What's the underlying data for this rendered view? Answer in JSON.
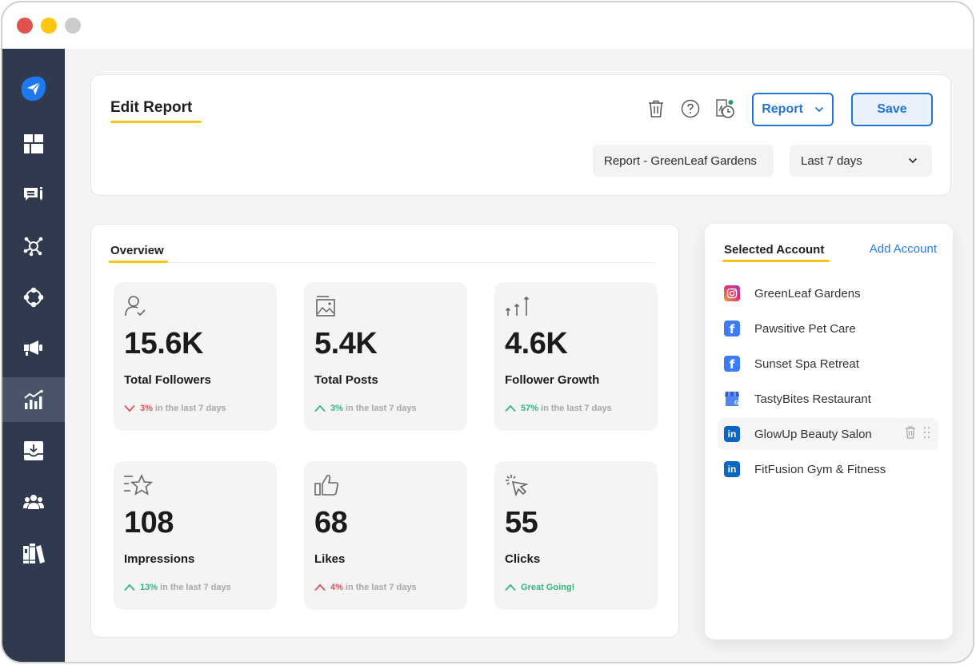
{
  "window": {
    "controls": [
      "close",
      "minimize",
      "maximize"
    ]
  },
  "sidebar": {
    "items": [
      {
        "name": "send",
        "icon": "paper-plane-icon",
        "active": false
      },
      {
        "name": "dashboard",
        "icon": "dashboard-grid-icon",
        "active": false
      },
      {
        "name": "messages",
        "icon": "chat-edit-icon",
        "active": false
      },
      {
        "name": "network",
        "icon": "network-hub-icon",
        "active": false
      },
      {
        "name": "connections",
        "icon": "circle-nodes-icon",
        "active": false
      },
      {
        "name": "campaigns",
        "icon": "megaphone-icon",
        "active": false
      },
      {
        "name": "reports",
        "icon": "analytics-chart-icon",
        "active": true
      },
      {
        "name": "inbox",
        "icon": "inbox-download-icon",
        "active": false
      },
      {
        "name": "team",
        "icon": "users-group-icon",
        "active": false
      },
      {
        "name": "library",
        "icon": "books-library-icon",
        "active": false
      }
    ]
  },
  "header": {
    "title": "Edit Report",
    "actions": {
      "delete_icon": "trash-icon",
      "help_icon": "help-circle-icon",
      "schedule_icon": "schedule-report-icon",
      "report_dropdown_label": "Report",
      "save_label": "Save"
    },
    "report_name": "Report - GreenLeaf Gardens",
    "date_range": {
      "selected": "Last 7 days"
    }
  },
  "overview": {
    "tab_label": "Overview",
    "stats": [
      {
        "icon": "user-check-icon",
        "value": "15.6K",
        "label": "Total Followers",
        "trend": "down",
        "change": "3%",
        "suffix": "in the last 7 days",
        "color": "#e0505a"
      },
      {
        "icon": "image-post-icon",
        "value": "5.4K",
        "label": "Total Posts",
        "trend": "up",
        "change": "3%",
        "suffix": "in the last 7 days",
        "color": "#32b67c"
      },
      {
        "icon": "growth-arrows-icon",
        "value": "4.6K",
        "label": "Follower Growth",
        "trend": "up",
        "change": "57%",
        "suffix": "in the last 7 days",
        "color": "#32b67c"
      },
      {
        "icon": "star-impressions-icon",
        "value": "108",
        "label": "Impressions",
        "trend": "up",
        "change": "13%",
        "suffix": "in the last 7 days",
        "color": "#32b67c"
      },
      {
        "icon": "thumbs-up-icon",
        "value": "68",
        "label": "Likes",
        "trend": "up",
        "change": "4%",
        "suffix": "in the last 7 days",
        "color": "#e0505a"
      },
      {
        "icon": "cursor-click-icon",
        "value": "55",
        "label": "Clicks",
        "trend": "up",
        "change": "Great Going!",
        "suffix": "",
        "color": "#32b67c"
      }
    ]
  },
  "accounts": {
    "tab_label": "Selected Account",
    "add_label": "Add Account",
    "items": [
      {
        "network": "instagram",
        "name": "GreenLeaf Gardens"
      },
      {
        "network": "facebook",
        "name": "Pawsitive Pet Care"
      },
      {
        "network": "facebook",
        "name": "Sunset Spa Retreat"
      },
      {
        "network": "google-business",
        "name": "TastyBites Restaurant"
      },
      {
        "network": "linkedin",
        "name": "GlowUp Beauty Salon",
        "hovered": true
      },
      {
        "network": "linkedin",
        "name": "FitFusion Gym & Fitness"
      }
    ]
  },
  "colors": {
    "accent_yellow": "#f7c513",
    "primary_blue": "#2474d8",
    "sidebar_bg": "#2f3a4e",
    "positive": "#32b67c",
    "negative": "#e0505a"
  }
}
